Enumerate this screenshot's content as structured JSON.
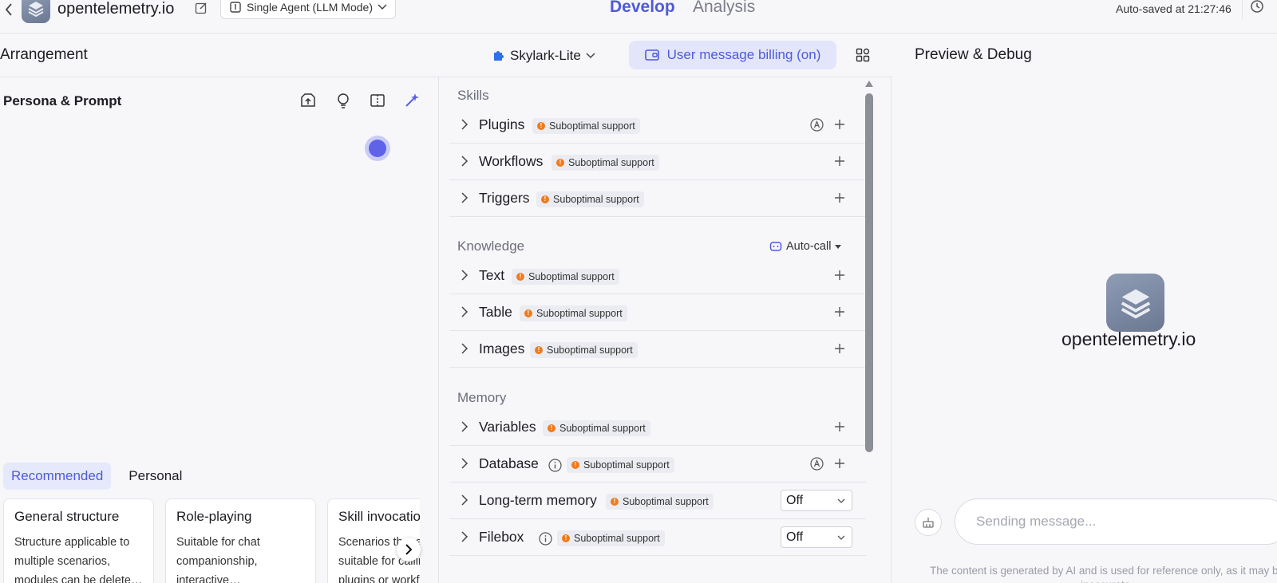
{
  "header": {
    "app_title": "opentelemetry.io",
    "mode": "Single Agent (LLM Mode)",
    "tabs": [
      {
        "label": "Develop",
        "active": true
      },
      {
        "label": "Analysis",
        "active": false
      }
    ],
    "autosave": "Auto-saved at 21:27:46"
  },
  "arrangement": {
    "title": "Arrangement",
    "model": "Skylark-Lite",
    "billing": "User message billing (on)"
  },
  "persona": {
    "title": "Persona & Prompt",
    "template_tabs": [
      "Recommended",
      "Personal"
    ],
    "cards": [
      {
        "title": "General structure",
        "desc": "Structure applicable to multiple scenarios, modules can be delete…"
      },
      {
        "title": "Role-playing",
        "desc": "Suitable for chat companionship, interactive…"
      },
      {
        "title": "Skill invocation",
        "desc": "Scenarios that are suitable for calling plugins or workflows"
      }
    ]
  },
  "skills": {
    "skills_title": "Skills",
    "knowledge_title": "Knowledge",
    "memory_title": "Memory",
    "autocall": "Auto-call",
    "badge": "Suboptimal support",
    "rows": {
      "plugins": "Plugins",
      "workflows": "Workflows",
      "triggers": "Triggers",
      "text": "Text",
      "table": "Table",
      "images": "Images",
      "variables": "Variables",
      "database": "Database",
      "longterm": "Long-term memory",
      "filebox": "Filebox"
    },
    "off_value": "Off"
  },
  "preview": {
    "title": "Preview & Debug",
    "bot_name": "opentelemetry.io",
    "input_placeholder": "Sending message...",
    "disclaimer": "The content is generated by AI and is used for reference only, as it may be inaccurate."
  },
  "colors": {
    "accent": "#4e5bd8",
    "warning": "#f07a1c",
    "billing_bg": "#e3e5fb"
  }
}
